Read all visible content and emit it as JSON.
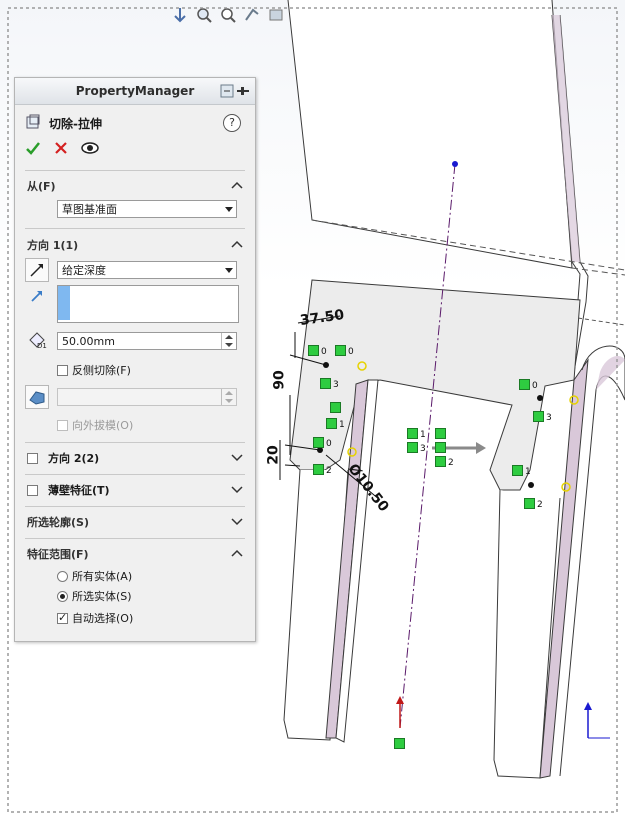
{
  "property_manager": {
    "title": "PropertyManager",
    "feature_name": "切除-拉伸",
    "help_label": "?",
    "from": {
      "label": "从(F)",
      "value": "草图基准面"
    },
    "direction1": {
      "label": "方向 1(1)",
      "end_condition": "给定深度",
      "depth": "50.00mm",
      "depth_icon_label": "D1",
      "flip_side": "反侧切除(F)",
      "draft_outward": "向外拔模(O)"
    },
    "direction2": {
      "label": "方向 2(2)"
    },
    "thin_feature": {
      "label": "薄壁特征(T)"
    },
    "selected_contours": {
      "label": "所选轮廓(S)"
    },
    "feature_scope": {
      "label": "特征范围(F)",
      "all_bodies": "所有实体(A)",
      "selected_bodies": "所选实体(S)",
      "auto_select": "自动选择(O)",
      "selected_option": "selected_bodies",
      "auto_select_checked": true
    }
  },
  "dimensions": {
    "d1": "37.50",
    "d2": "90",
    "d3": "20",
    "d4": "Ø10.50"
  },
  "relation_labels": {
    "zero": "0",
    "one": "1",
    "two": "2",
    "three": "3"
  },
  "colors": {
    "accept": "#2a9d2a",
    "cancel": "#d42020",
    "relation_green": "#2ecc40",
    "part_edge": "#3a3a3a",
    "part_side": "#d9c8d9"
  }
}
